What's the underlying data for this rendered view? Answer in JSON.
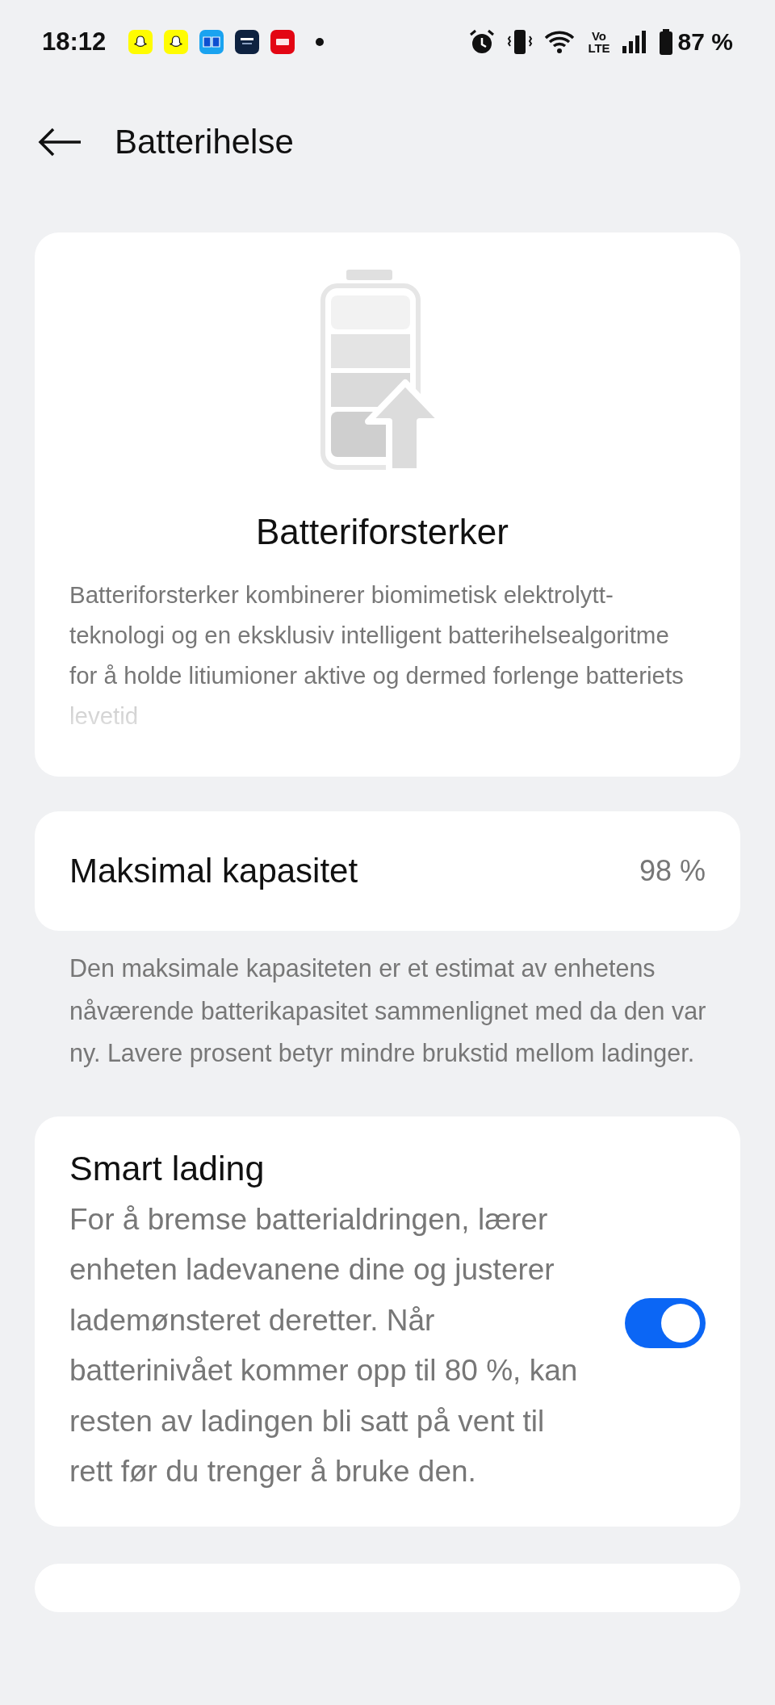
{
  "status_bar": {
    "time": "18:12",
    "volte_top": "Vo",
    "volte_bottom": "LTE",
    "battery": "87 %"
  },
  "header": {
    "title": "Batterihelse"
  },
  "booster_card": {
    "title": "Batteriforsterker",
    "description": "Batteriforsterker kombinerer biomimetisk elektrolytt-teknologi og en eksklusiv intelligent batterihelsealgoritme for å holde litiumioner aktive og dermed forlenge batteriets levetid"
  },
  "capacity": {
    "label": "Maksimal kapasitet",
    "value": "98 %",
    "note": "Den maksimale kapasiteten er et estimat av enhetens nåværende batterikapasitet sammenlignet med da den var ny. Lavere prosent betyr mindre brukstid mellom ladinger."
  },
  "smart_charging": {
    "title": "Smart lading",
    "description": "For å bremse batterialdringen, lærer enheten ladevanene dine og justerer lademønsteret deretter. Når batterinivået kommer opp til 80 %, kan resten av ladingen bli satt på vent til rett før du trenger å bruke den.",
    "on": true
  }
}
